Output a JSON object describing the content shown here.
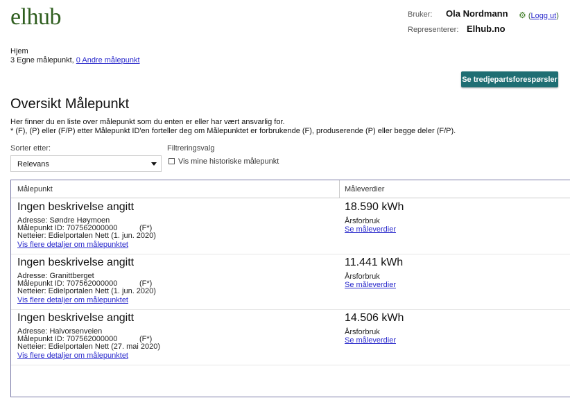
{
  "header": {
    "logo": "elhub",
    "user_label": "Bruker:",
    "user_name": "Ola Nordmann",
    "logout_label": "Logg ut",
    "represent_label": "Representerer:",
    "represent_value": "Elhub.no",
    "gear_icon": "gear-icon"
  },
  "breadcrumb": {
    "home": "Hjem",
    "own_count_text": "3 Egne målepunkt,",
    "other_link": "0 Andre målepunkt"
  },
  "third_party_button": "Se tredjepartsforespørsler",
  "page": {
    "title": "Oversikt Målepunkt",
    "desc_line1": "Her finner du en liste over målepunkt som du enten er eller har vært ansvarlig for.",
    "desc_line2": "* (F), (P) eller (F/P) etter Målepunkt ID'en forteller deg om Målepunktet er forbrukende (F),  produserende (P) eller begge deler (F/P)."
  },
  "controls": {
    "sort_label": "Sorter etter:",
    "sort_value": "Relevans",
    "filter_label": "Filtreringsvalg",
    "history_checkbox_label": "Vis mine historiske målepunkt"
  },
  "table": {
    "col_malepunkt": "Målepunkt",
    "col_maleverdier": "Måleverdier",
    "rows": [
      {
        "title": "Ingen beskrivelse angitt",
        "address": "Adresse: Søndre Høymoen",
        "id": "Målepunkt ID: 707562000000",
        "fp": "(F*)",
        "owner": "Netteier: Edielportalen Nett (1. jun. 2020)",
        "details_link": "Vis flere detaljer om målepunktet",
        "value": "18.590 kWh",
        "value_type": "Årsforbruk",
        "values_link": "Se måleverdier"
      },
      {
        "title": "Ingen beskrivelse angitt",
        "address": "Adresse: Granittberget",
        "id": "Målepunkt ID: 707562000000",
        "fp": "(F*)",
        "owner": "Netteier: Edielportalen Nett (1. jun. 2020)",
        "details_link": "Vis flere detaljer om målepunktet",
        "value": "11.441 kWh",
        "value_type": "Årsforbruk",
        "values_link": "Se måleverdier"
      },
      {
        "title": "Ingen beskrivelse angitt",
        "address": "Adresse: Halvorsenveien",
        "id": "Målepunkt ID: 707562000000",
        "fp": "(F*)",
        "owner": "Netteier: Edielportalen Nett (27. mai 2020)",
        "details_link": "Vis flere detaljer om målepunktet",
        "value": "14.506 kWh",
        "value_type": "Årsforbruk",
        "values_link": "Se måleverdier"
      }
    ]
  }
}
